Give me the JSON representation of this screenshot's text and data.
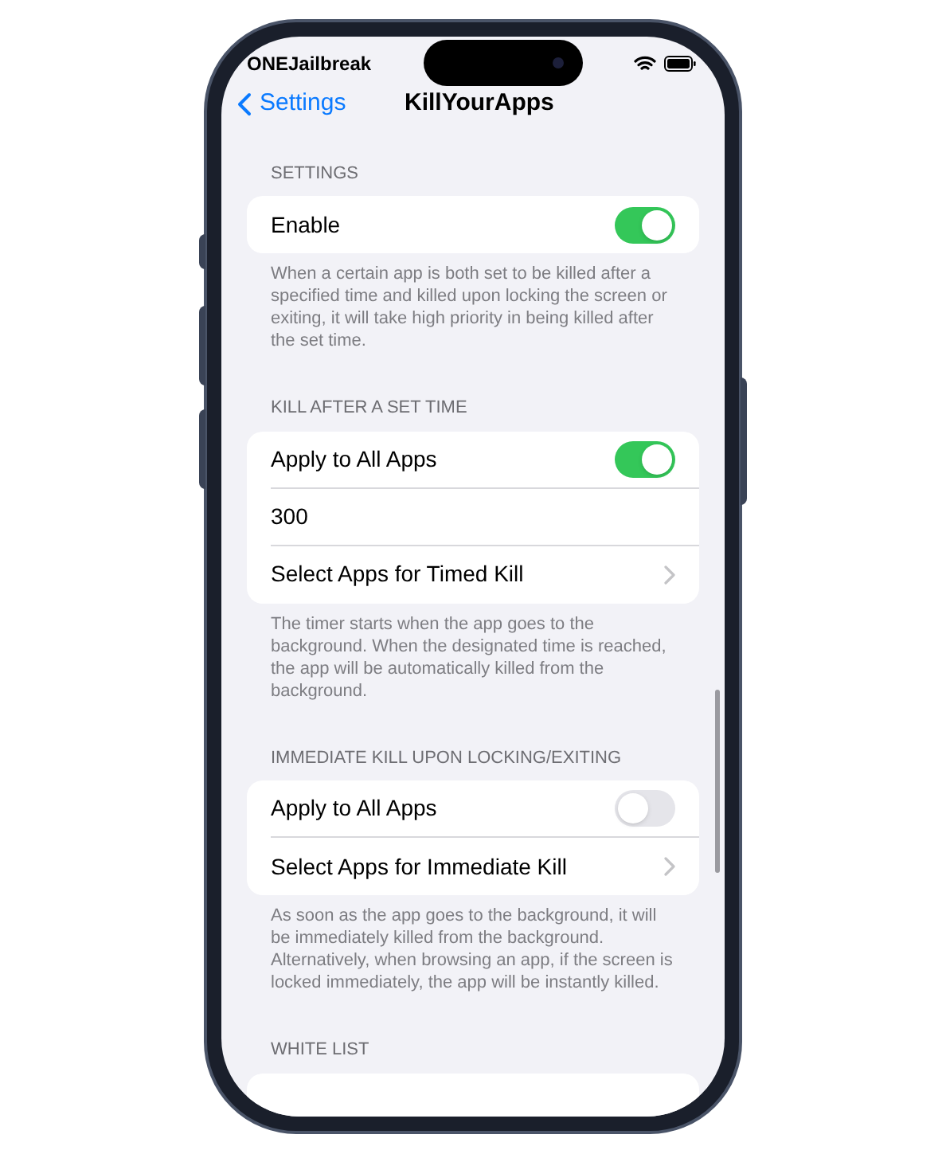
{
  "status_bar": {
    "carrier": "ONEJailbreak"
  },
  "nav": {
    "back": "Settings",
    "title": "KillYourApps"
  },
  "sections": [
    {
      "header": "SETTINGS",
      "rows": [
        {
          "kind": "toggle",
          "label": "Enable",
          "on": true
        }
      ],
      "footer": "When a certain app is both set to be killed after a specified time and killed upon locking the screen or exiting, it will take high priority in being killed after the set time."
    },
    {
      "header": "KILL AFTER A SET TIME",
      "rows": [
        {
          "kind": "toggle",
          "label": "Apply to All Apps",
          "on": true
        },
        {
          "kind": "field",
          "value": "300"
        },
        {
          "kind": "link",
          "label": "Select Apps for Timed Kill"
        }
      ],
      "footer": "The timer starts when the app goes to the background. When the designated time is reached, the app will be automatically killed from the background."
    },
    {
      "header": "IMMEDIATE KILL UPON LOCKING/EXITING",
      "rows": [
        {
          "kind": "toggle",
          "label": "Apply to All Apps",
          "on": false
        },
        {
          "kind": "link",
          "label": "Select Apps for Immediate Kill"
        }
      ],
      "footer": "As soon as the app goes to the background, it will be immediately killed from the background. Alternatively, when browsing an app, if the screen is locked immediately, the app will be instantly killed."
    },
    {
      "header": "WHITE LIST"
    }
  ]
}
